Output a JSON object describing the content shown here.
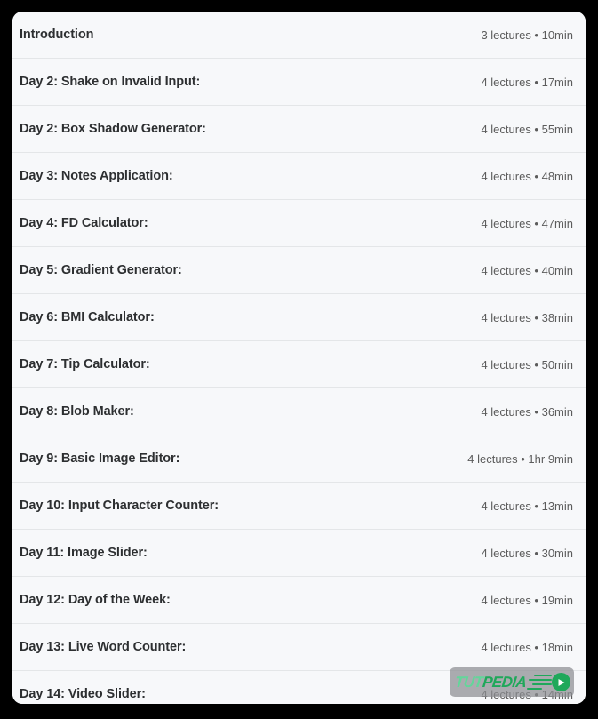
{
  "card": {
    "name": "course-curriculum-card",
    "background_color": "#f7f8fa",
    "divider_color": "#e4e6e8",
    "title_color": "#2d2f31",
    "meta_color": "#5c5c5c",
    "page_background": "#000000"
  },
  "sections": [
    {
      "title": "Introduction",
      "meta": "3 lectures • 10min"
    },
    {
      "title": "Day 2: Shake on Invalid Input:",
      "meta": "4 lectures • 17min"
    },
    {
      "title": "Day 2: Box Shadow Generator:",
      "meta": "4 lectures • 55min"
    },
    {
      "title": "Day 3: Notes Application:",
      "meta": "4 lectures • 48min"
    },
    {
      "title": "Day 4: FD Calculator:",
      "meta": "4 lectures • 47min"
    },
    {
      "title": "Day 5: Gradient Generator:",
      "meta": "4 lectures • 40min"
    },
    {
      "title": "Day 6: BMI Calculator:",
      "meta": "4 lectures • 38min"
    },
    {
      "title": "Day 7: Tip Calculator:",
      "meta": "4 lectures • 50min"
    },
    {
      "title": "Day 8: Blob Maker:",
      "meta": "4 lectures • 36min"
    },
    {
      "title": "Day 9: Basic Image Editor:",
      "meta": "4 lectures • 1hr 9min"
    },
    {
      "title": "Day 10: Input Character Counter:",
      "meta": "4 lectures • 13min"
    },
    {
      "title": "Day 11: Image Slider:",
      "meta": "4 lectures • 30min"
    },
    {
      "title": "Day 12: Day of the Week:",
      "meta": "4 lectures • 19min"
    },
    {
      "title": "Day 13: Live Word Counter:",
      "meta": "4 lectures • 18min"
    },
    {
      "title": "Day 14: Video Slider:",
      "meta": "4 lectures • 14min"
    }
  ],
  "watermark": {
    "text_primary": "TUT",
    "text_secondary": "PEDIA",
    "primary_color": "#63d69a",
    "secondary_color": "#1fa85a",
    "background_color": "rgba(140,142,145,0.72)",
    "play_icon": "play-icon"
  }
}
